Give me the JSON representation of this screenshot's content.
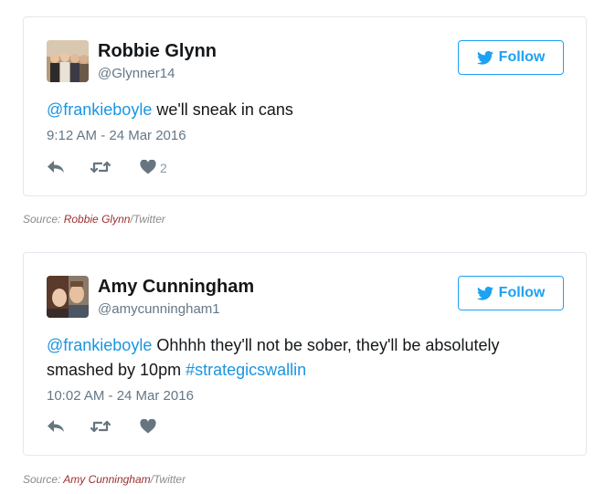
{
  "tweets": [
    {
      "author_name": "Robbie Glynn",
      "handle": "@Glynner14",
      "follow_label": "Follow",
      "text_segments": [
        {
          "text": "@frankieboyle",
          "type": "link"
        },
        {
          "text": " we'll sneak in cans",
          "type": "text"
        }
      ],
      "timestamp": "9:12 AM - 24 Mar 2016",
      "like_count": "2",
      "icons": [
        "reply-icon",
        "retweet-icon",
        "heart-icon",
        "twitter-bird-icon"
      ]
    },
    {
      "author_name": "Amy Cunningham",
      "handle": "@amycunningham1",
      "follow_label": "Follow",
      "text_segments": [
        {
          "text": "@frankieboyle",
          "type": "link"
        },
        {
          "text": " Ohhhh they'll not be sober, they'll be absolutely smashed by 10pm ",
          "type": "text"
        },
        {
          "text": "#strategicswallin",
          "type": "link"
        }
      ],
      "timestamp": "10:02 AM - 24 Mar 2016",
      "like_count": "",
      "icons": [
        "reply-icon",
        "retweet-icon",
        "heart-icon",
        "twitter-bird-icon"
      ]
    }
  ],
  "sources": [
    {
      "prefix": "Source: ",
      "name": "Robbie Glynn",
      "suffix": "/Twitter"
    },
    {
      "prefix": "Source: ",
      "name": "Amy Cunningham",
      "suffix": "/Twitter"
    }
  ],
  "colors": {
    "accent": "#1da1f2",
    "link": "#1b95e0",
    "muted": "#657786",
    "icon": "#8899a6",
    "border": "#e1e8ed",
    "source_name": "#9b2f2f"
  }
}
